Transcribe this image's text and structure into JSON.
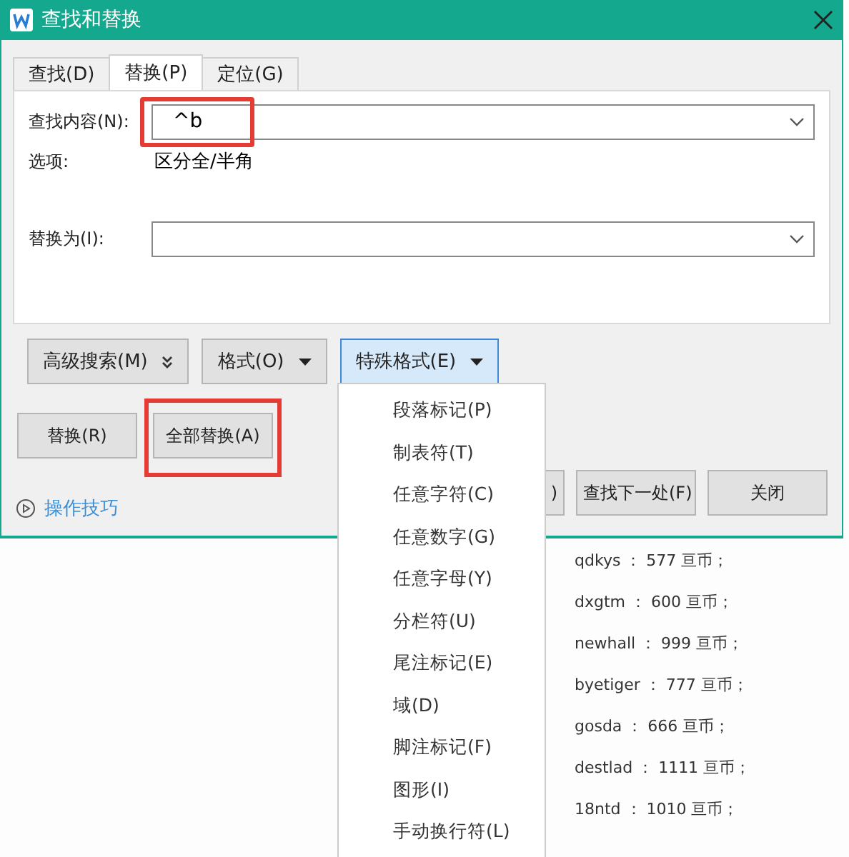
{
  "window": {
    "title": "查找和替换"
  },
  "tabs": [
    {
      "label": "查找(D)",
      "selected": false
    },
    {
      "label": "替换(P)",
      "selected": true
    },
    {
      "label": "定位(G)",
      "selected": false
    }
  ],
  "find": {
    "label": "查找内容(N):",
    "value": "^b",
    "highlighted": true
  },
  "options": {
    "label": "选项:",
    "value": "区分全/半角"
  },
  "replace": {
    "label": "替换为(I):"
  },
  "option_buttons": [
    {
      "label": "高级搜索(M)",
      "kind": "double",
      "selected": false
    },
    {
      "label": "格式(O)",
      "kind": "caret",
      "selected": false
    },
    {
      "label": "特殊格式(E)",
      "kind": "caret",
      "selected": true
    }
  ],
  "action_buttons": [
    {
      "label": "替换(R)",
      "highlighted": false
    },
    {
      "label": "全部替换(A)",
      "highlighted": true
    }
  ],
  "right_buttons": [
    {
      "label": ")",
      "partial": true
    },
    {
      "label": "查找下一处(F)",
      "partial": false
    },
    {
      "label": "关闭",
      "partial": false
    }
  ],
  "help_link": "操作技巧",
  "special_menu": [
    "段落标记(P)",
    "制表符(T)",
    "任意字符(C)",
    "任意数字(G)",
    "任意字母(Y)",
    "分栏符(U)",
    "尾注标记(E)",
    "域(D)",
    "脚注标记(F)",
    "图形(I)",
    "手动换行符(L)"
  ],
  "document_lines": [
    "qdkys ： 577 亘币；",
    "dxgtm ： 600 亘币；",
    "newhall ： 999 亘币；",
    "byetiger ： 777 亘币；",
    "gosda ： 666 亘币；",
    "destlad ： 1111 亘币；",
    "18ntd ： 1010 亘币；"
  ]
}
